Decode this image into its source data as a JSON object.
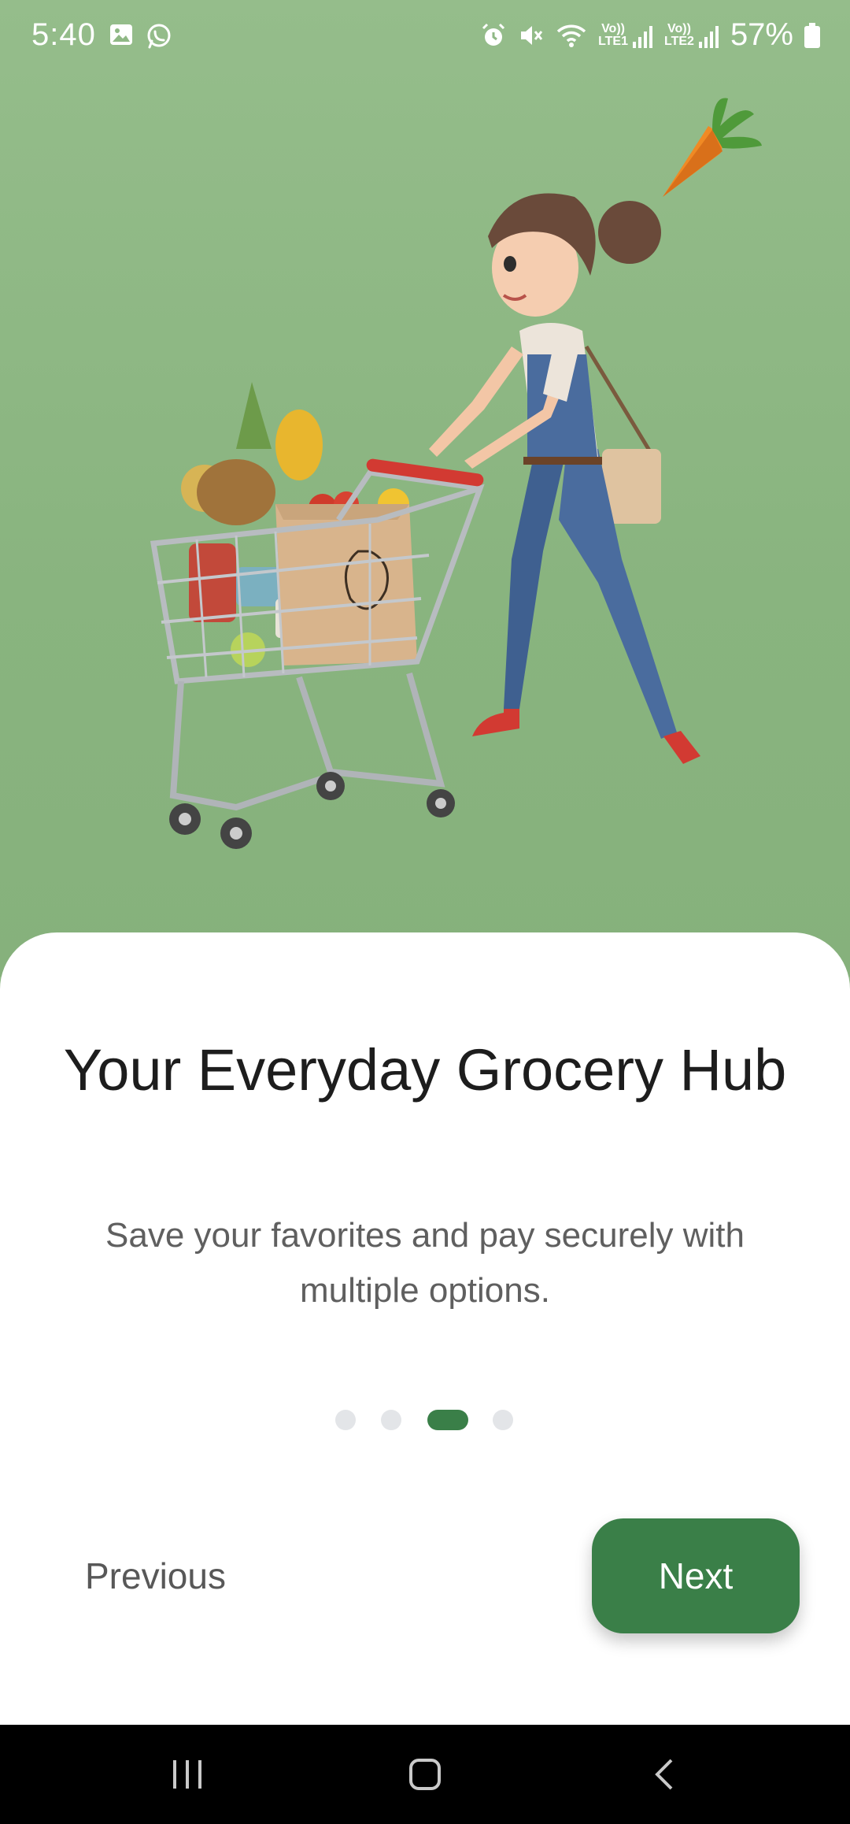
{
  "status_bar": {
    "time": "5:40",
    "battery": "57%",
    "left_icons": [
      "gallery-icon",
      "whatsapp-icon"
    ],
    "right_icons": [
      "alarm-icon",
      "mute-icon",
      "wifi-icon",
      "signal-sim1-icon",
      "signal-sim2-icon",
      "battery-icon"
    ],
    "sim1_top": "Vo))",
    "sim1_bottom": "LTE1",
    "sim2_top": "Vo))",
    "sim2_bottom": "LTE2"
  },
  "onboarding": {
    "title": "Your Everyday Grocery Hub",
    "subtitle": "Save your favorites and pay securely with multiple options.",
    "page_count": 4,
    "current_page": 3,
    "previous_label": "Previous",
    "next_label": "Next"
  },
  "colors": {
    "hero_background": "#8fb885",
    "accent": "#3a7f48",
    "dot_inactive": "#e3e5e8"
  },
  "navigation_bar": {
    "buttons": [
      "recents-icon",
      "home-icon",
      "back-icon"
    ]
  }
}
